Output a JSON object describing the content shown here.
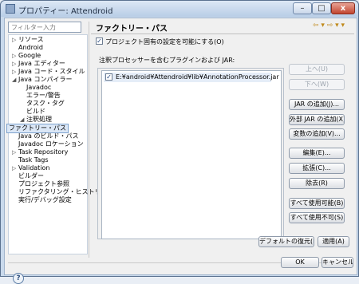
{
  "window": {
    "title": "プロパティー: Attendroid",
    "minimize": "–",
    "maximize": "□",
    "close": "x"
  },
  "filter": {
    "placeholder": "フィルター入力"
  },
  "tree": [
    {
      "label": "リソース",
      "twisty": "▷"
    },
    {
      "label": "Android",
      "twisty": ""
    },
    {
      "label": "Google",
      "twisty": "▷"
    },
    {
      "label": "Java エディター",
      "twisty": "▷"
    },
    {
      "label": "Java コード・スタイル",
      "twisty": "▷"
    },
    {
      "label": "Java コンパイラー",
      "twisty": "◢"
    },
    {
      "label": "Javadoc",
      "twisty": ""
    },
    {
      "label": "エラー/警告",
      "twisty": ""
    },
    {
      "label": "タスク・タグ",
      "twisty": ""
    },
    {
      "label": "ビルド",
      "twisty": ""
    },
    {
      "label": "注釈処理",
      "twisty": "◢"
    },
    {
      "label": "ファクトリー・パス",
      "twisty": "",
      "selected": true
    },
    {
      "label": "Java のビルド・パス",
      "twisty": ""
    },
    {
      "label": "Javadoc ロケーション",
      "twisty": ""
    },
    {
      "label": "Task Repository",
      "twisty": "▷"
    },
    {
      "label": "Task Tags",
      "twisty": ""
    },
    {
      "label": "Validation",
      "twisty": "▷"
    },
    {
      "label": "ビルダー",
      "twisty": ""
    },
    {
      "label": "プロジェクト参照",
      "twisty": ""
    },
    {
      "label": "リファクタリング・ヒストリー",
      "twisty": ""
    },
    {
      "label": "実行/デバッグ設定",
      "twisty": ""
    }
  ],
  "page": {
    "title": "ファクトリー・パス",
    "nav": "⇦ ▾ ⇨ ▾ ▾",
    "enable_label": "プロジェクト固有の設定を可能にする(O)",
    "enable_mark": "✓",
    "list_label": "注釈プロセッサーを含むプラグインおよび JAR:",
    "jar_mark": "✓",
    "jar_path": "E:¥android¥Attendroid¥lib¥AnnotationProcessor.jar"
  },
  "buttons": {
    "up": "上へ(U)",
    "down": "下へ(W)",
    "add_jar": "JAR の追加(J)...",
    "add_external_jar": "外部 JAR の追加(X)...",
    "add_variable": "変数の追加(V)...",
    "edit": "編集(E)...",
    "advanced": "拡張(C)...",
    "remove": "除去(R)",
    "enable_all": "すべて使用可能(B)",
    "disable_all": "すべて使用不可(S)",
    "restore_defaults": "デフォルトの復元(D)",
    "apply": "適用(A)",
    "ok": "OK",
    "cancel": "キャンセル",
    "help": "?"
  }
}
